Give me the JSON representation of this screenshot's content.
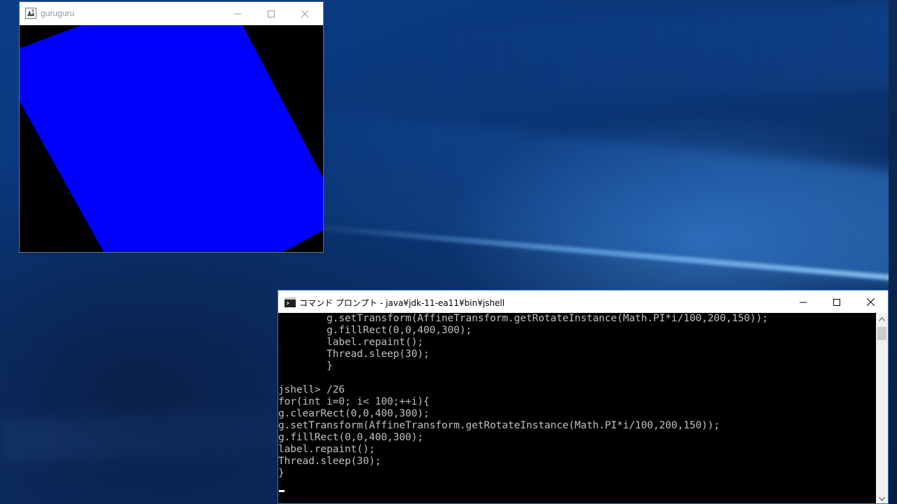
{
  "desktop": {
    "wallpaper": "windows-10-hero-blue",
    "accent_color": "#0b3d86"
  },
  "java_window": {
    "title": "guruguru",
    "icon": "java-app-icon",
    "canvas_background": "#000000",
    "shape_color": "#0000ff",
    "controls": {
      "minimize_icon": "minimize-icon",
      "maximize_icon": "maximize-icon",
      "close_icon": "close-icon"
    }
  },
  "cmd_window": {
    "title": "コマンド プロンプト - java¥jdk-11-ea11¥bin¥jshell",
    "icon": "console-icon",
    "console_text_color": "#c0c0c0",
    "lines": [
      "        g.setTransform(AffineTransform.getRotateInstance(Math.PI*i/100,200,150));",
      "        g.fillRect(0,0,400,300);",
      "        label.repaint();",
      "        Thread.sleep(30);",
      "        }",
      "",
      "jshell> /26",
      "for(int i=0; i< 100;++i){",
      "g.clearRect(0,0,400,300);",
      "g.setTransform(AffineTransform.getRotateInstance(Math.PI*i/100,200,150));",
      "g.fillRect(0,0,400,300);",
      "label.repaint();",
      "Thread.sleep(30);",
      "}"
    ],
    "controls": {
      "minimize_icon": "minimize-icon",
      "maximize_icon": "maximize-icon",
      "close_icon": "close-icon"
    },
    "scrollbar": {
      "up_icon": "scroll-up-arrow-icon",
      "down_icon": "scroll-down-arrow-icon"
    }
  }
}
